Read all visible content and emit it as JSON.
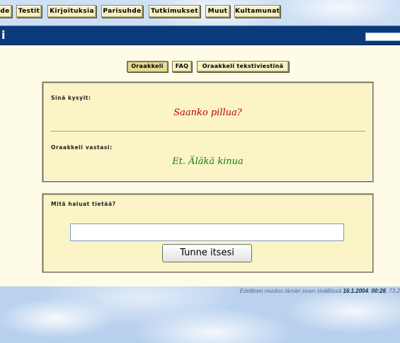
{
  "nav": {
    "items": [
      {
        "label": "de"
      },
      {
        "label": "Testit"
      },
      {
        "label": "Kirjoituksia"
      },
      {
        "label": "Parisuhde"
      },
      {
        "label": "Tutkimukset"
      },
      {
        "label": "Muut"
      },
      {
        "label": "Kultamunat"
      }
    ]
  },
  "titlebar": {
    "title_fragment": "i"
  },
  "tabs": [
    {
      "label": "Oraakkeli",
      "active": true
    },
    {
      "label": "FAQ",
      "active": false
    },
    {
      "label": "Oraakkeli tekstiviestinä",
      "active": false
    }
  ],
  "oracle": {
    "asked_label": "Sinä kysyit:",
    "question": "Saanko pillua?",
    "answered_label": "Oraakkeli vastasi:",
    "answer": "Et. Äläkä kinua"
  },
  "form": {
    "prompt_label": "Mitä haluat tietää?",
    "input_value": "",
    "submit_label": "Tunne itsesi"
  },
  "footer": {
    "text_prefix": "Edellinen muutos tämän sivun sisällössä",
    "date": "16.1.2004",
    "sep": ",",
    "time": "00:28",
    "suffix": ", 73.2"
  },
  "colors": {
    "titlebar": "#0a3a7a",
    "panel": "#fefce6",
    "box": "#fbf4c6",
    "button": "#f7f1c2",
    "question_text": "#c00000",
    "answer_text": "#108010"
  }
}
